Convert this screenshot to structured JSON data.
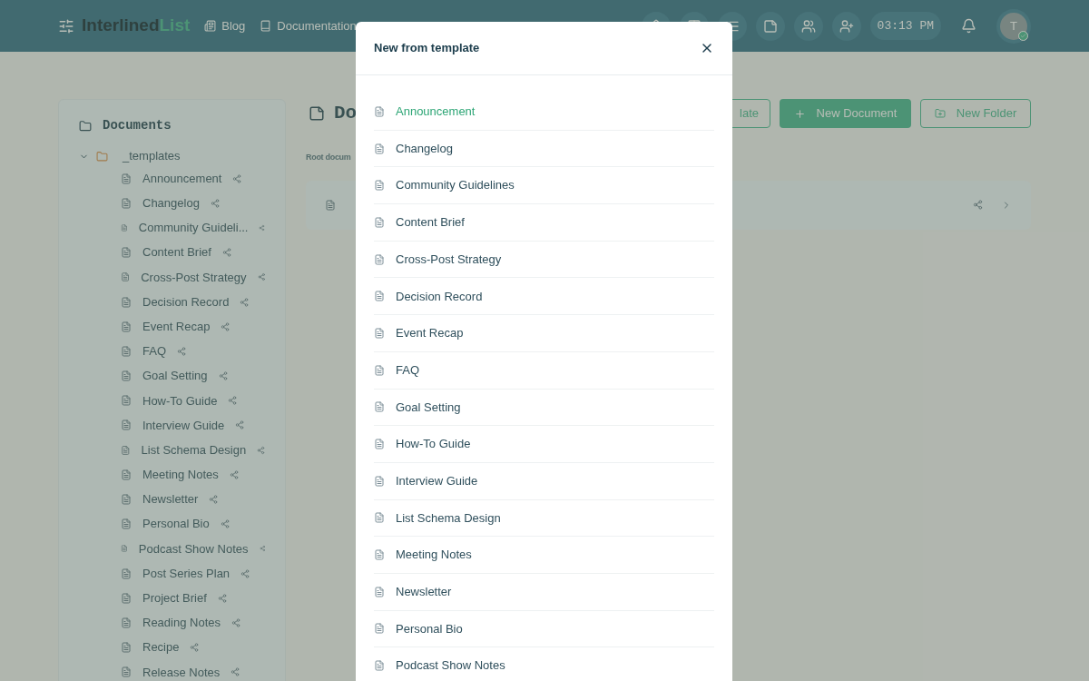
{
  "header": {
    "logo": {
      "first": "Interlined",
      "second": "List"
    },
    "nav": [
      "Blog",
      "Documentation"
    ],
    "time": "03:13 PM",
    "avatar": {
      "initial": "T",
      "online": true
    }
  },
  "sidebar": {
    "title": "Documents",
    "tree": [
      {
        "label": "_templates",
        "expanded": true,
        "children": [
          {
            "label": "Announcement"
          },
          {
            "label": "Changelog"
          },
          {
            "label": "Community Guideli..."
          },
          {
            "label": "Content Brief"
          },
          {
            "label": "Cross-Post Strategy"
          },
          {
            "label": "Decision Record"
          },
          {
            "label": "Event Recap"
          },
          {
            "label": "FAQ"
          },
          {
            "label": "Goal Setting"
          },
          {
            "label": "How-To Guide"
          },
          {
            "label": "Interview Guide"
          },
          {
            "label": "List Schema Design"
          },
          {
            "label": "Meeting Notes"
          },
          {
            "label": "Newsletter"
          },
          {
            "label": "Personal Bio"
          },
          {
            "label": "Podcast Show Notes"
          },
          {
            "label": "Post Series Plan"
          },
          {
            "label": "Project Brief"
          },
          {
            "label": "Reading Notes"
          },
          {
            "label": "Recipe"
          },
          {
            "label": "Release Notes"
          }
        ]
      }
    ]
  },
  "main": {
    "title": "Do",
    "buttons": [
      "late",
      "New Document",
      "New Folder"
    ],
    "breadcrumb": "Root docum"
  },
  "modal": {
    "title": "New from template",
    "items": [
      {
        "label": "Announcement",
        "selected": true
      },
      {
        "label": "Changelog",
        "selected": false
      },
      {
        "label": "Community Guidelines",
        "selected": false
      },
      {
        "label": "Content Brief",
        "selected": false
      },
      {
        "label": "Cross-Post Strategy",
        "selected": false
      },
      {
        "label": "Decision Record",
        "selected": false
      },
      {
        "label": "Event Recap",
        "selected": false
      },
      {
        "label": "FAQ",
        "selected": false
      },
      {
        "label": "Goal Setting",
        "selected": false
      },
      {
        "label": "How-To Guide",
        "selected": false
      },
      {
        "label": "Interview Guide",
        "selected": false
      },
      {
        "label": "List Schema Design",
        "selected": false
      },
      {
        "label": "Meeting Notes",
        "selected": false
      },
      {
        "label": "Newsletter",
        "selected": false
      },
      {
        "label": "Personal Bio",
        "selected": false
      },
      {
        "label": "Podcast Show Notes",
        "selected": false
      }
    ]
  }
}
